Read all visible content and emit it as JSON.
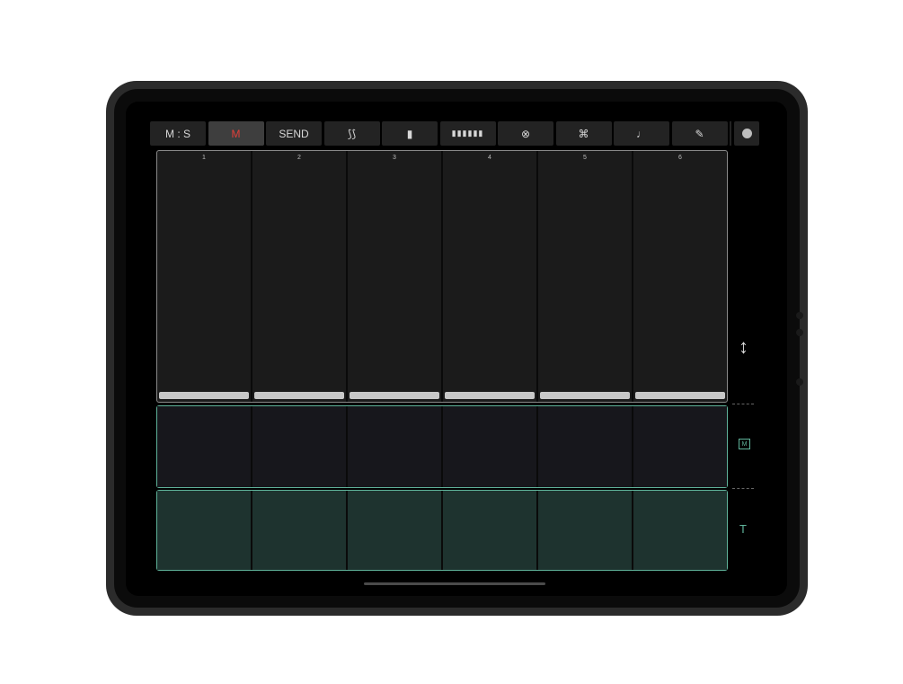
{
  "toolbar": {
    "buttons": [
      {
        "label": "M : S",
        "icon": "mute-solo"
      },
      {
        "label": "M",
        "icon": "mute",
        "active": true
      },
      {
        "label": "SEND",
        "icon": "send"
      },
      {
        "label": "⟆⟆",
        "icon": "envelope-icon"
      },
      {
        "label": "▮",
        "icon": "single-bar-icon"
      },
      {
        "label": "▮▮▮▮▮▮",
        "icon": "multi-bar-icon"
      },
      {
        "label": "⊗",
        "icon": "circle-cross-icon"
      },
      {
        "label": "⌘",
        "icon": "command-icon"
      },
      {
        "label": "♩",
        "icon": "note-icon"
      },
      {
        "label": "✎",
        "icon": "eraser-icon"
      }
    ],
    "active_color": "#e0403a",
    "record_icon": "record-dot-icon"
  },
  "channels": {
    "labels": [
      "1",
      "2",
      "3",
      "4",
      "5",
      "6"
    ]
  },
  "side": {
    "resize_icon": "↕",
    "mute_badge": "M",
    "trigger_label": "T"
  },
  "colors": {
    "accent": "#5fb39a",
    "trigger_fill": "#1e332f",
    "panel": "#1b1b1b"
  }
}
